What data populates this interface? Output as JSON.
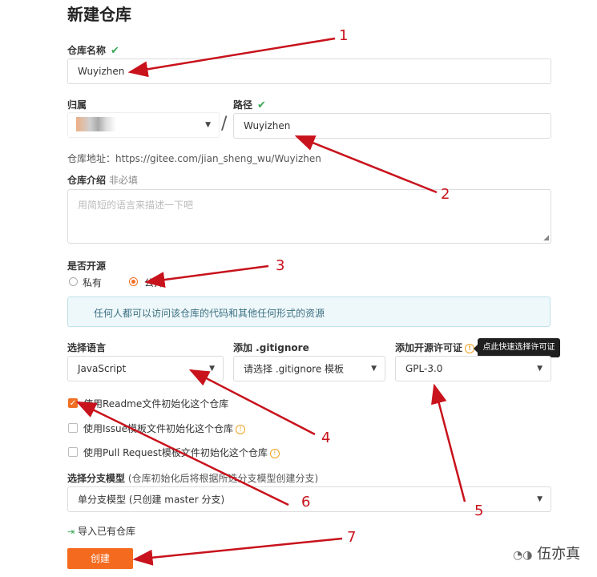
{
  "page": {
    "title": "新建仓库"
  },
  "repo_name": {
    "label": "仓库名称",
    "value": "Wuyizhen"
  },
  "owner": {
    "label": "归属"
  },
  "path": {
    "label": "路径",
    "value": "Wuyizhen",
    "separator": "/"
  },
  "repo_address": "仓库地址：https://gitee.com/jian_sheng_wu/Wuyizhen",
  "intro": {
    "label": "仓库介绍",
    "optional": "非必填",
    "placeholder": "用简短的语言来描述一下吧"
  },
  "open_source": {
    "label": "是否开源",
    "options": [
      "私有",
      "公开"
    ],
    "selected": "公开",
    "notice": "任何人都可以访问该仓库的代码和其他任何形式的资源"
  },
  "language": {
    "label": "选择语言",
    "value": "JavaScript"
  },
  "gitignore": {
    "label": "添加 .gitignore",
    "value": "请选择 .gitignore 模板"
  },
  "license": {
    "label": "添加开源许可证",
    "value": "GPL-3.0",
    "tooltip": "点此快速选择许可证"
  },
  "init_options": [
    {
      "label": "使用Readme文件初始化这个仓库",
      "checked": true
    },
    {
      "label": "使用Issue模板文件初始化这个仓库",
      "checked": false
    },
    {
      "label": "使用Pull Request模板文件初始化这个仓库",
      "checked": false
    }
  ],
  "branch_model": {
    "label": "选择分支模型",
    "hint": "(仓库初始化后将根据所选分支模型创建分支)",
    "value": "单分支模型 (只创建 master 分支)"
  },
  "import_link": "导入已有仓库",
  "create_button": "创建",
  "watermark": "伍亦真",
  "annotations": [
    "1",
    "2",
    "3",
    "4",
    "5",
    "6",
    "7"
  ],
  "colors": {
    "accent": "#f06f22",
    "success": "#3aa757",
    "annotation_red": "#c8121c",
    "info_bg": "#eef8fb"
  }
}
